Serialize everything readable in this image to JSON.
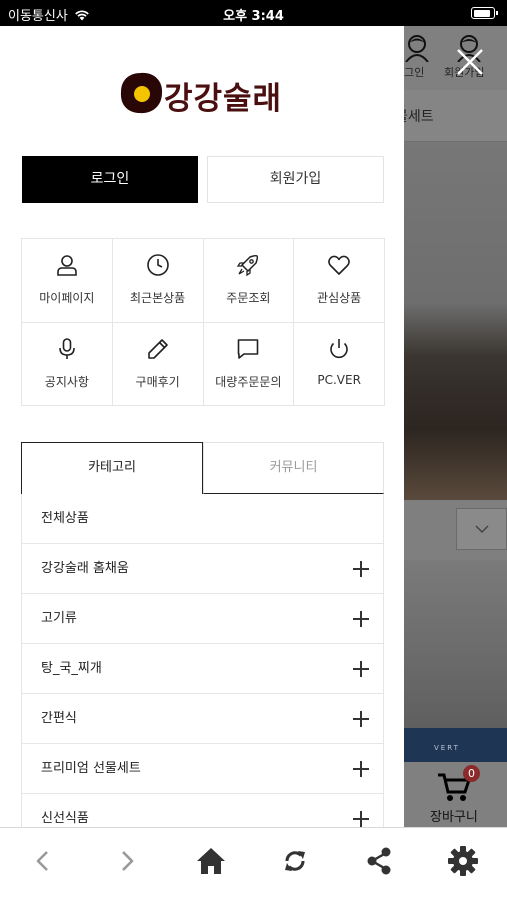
{
  "status_bar": {
    "carrier": "이동통신사",
    "time": "오후 3:44",
    "battery_level": 0.9
  },
  "drawer": {
    "logo": {
      "text": "강강술래"
    },
    "login_label": "로그인",
    "join_label": "회원가입",
    "quick_menu": [
      {
        "label": "마이페이지",
        "icon": "user-icon"
      },
      {
        "label": "최근본상품",
        "icon": "clock-icon"
      },
      {
        "label": "주문조회",
        "icon": "rocket-icon"
      },
      {
        "label": "관심상품",
        "icon": "heart-icon"
      },
      {
        "label": "공지사항",
        "icon": "microphone-icon"
      },
      {
        "label": "구매후기",
        "icon": "pencil-icon"
      },
      {
        "label": "대량주문문의",
        "icon": "chat-icon"
      },
      {
        "label": "PC.VER",
        "icon": "power-icon"
      }
    ],
    "tabs": {
      "category": "카테고리",
      "community": "커뮤니티"
    },
    "categories": [
      {
        "label": "전체상품",
        "expandable": false
      },
      {
        "label": "강강술래 홈채움",
        "expandable": true
      },
      {
        "label": "고기류",
        "expandable": true
      },
      {
        "label": "탕_국_찌개",
        "expandable": true
      },
      {
        "label": "간편식",
        "expandable": true
      },
      {
        "label": "프리미엄 선물세트",
        "expandable": true
      },
      {
        "label": "신선식품",
        "expandable": true
      }
    ]
  },
  "background": {
    "header_login": "로그인",
    "header_join": "회원가입",
    "subtitle": "물세트",
    "banner_text": "VERT",
    "cart_label": "장바구니",
    "cart_count": "0"
  },
  "toolbar": {
    "items": [
      "back-icon",
      "forward-icon",
      "home-icon",
      "refresh-icon",
      "share-icon",
      "settings-icon"
    ]
  },
  "colors": {
    "logo_text": "#4a0f0f",
    "logo_mark_yolk": "#f5c400",
    "login_button": "#000000"
  }
}
